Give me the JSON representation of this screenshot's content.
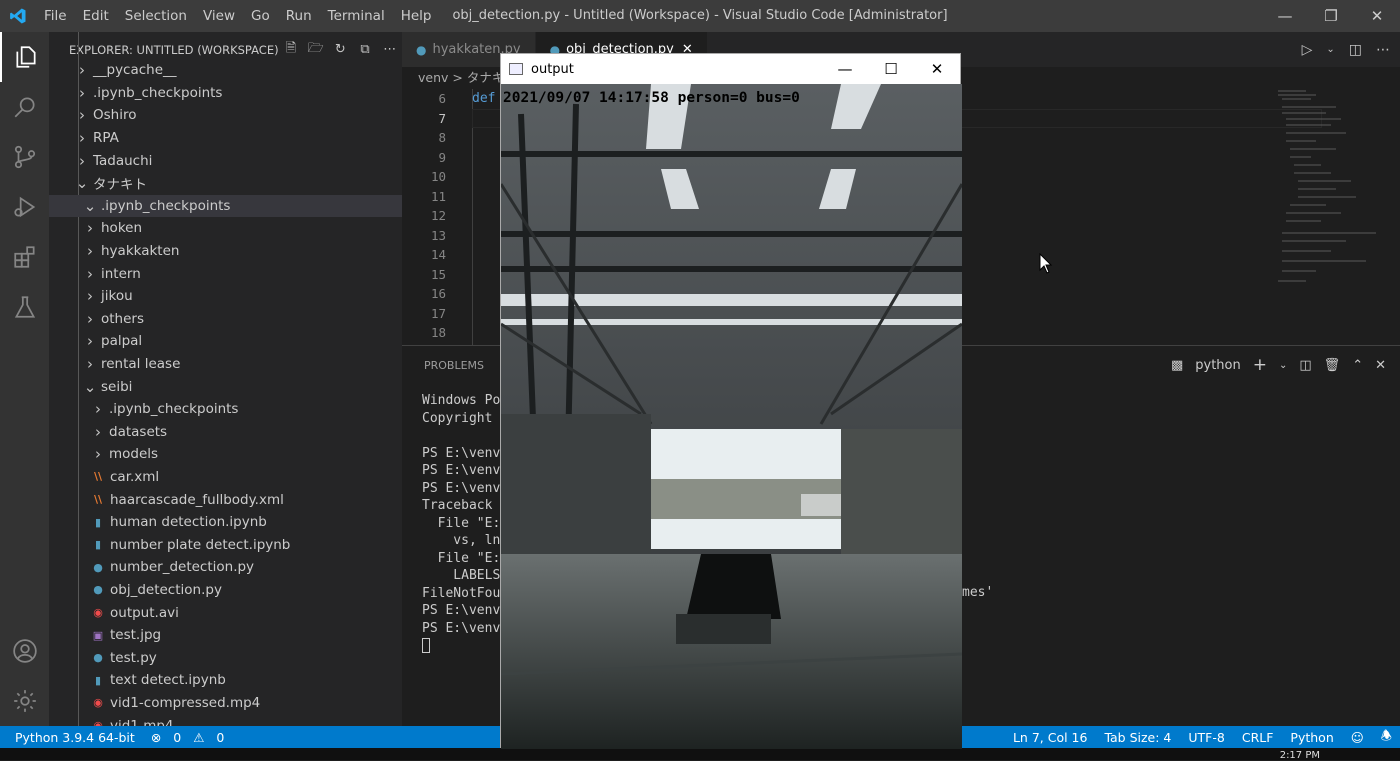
{
  "titlebar": {
    "menu": [
      "File",
      "Edit",
      "Selection",
      "View",
      "Go",
      "Run",
      "Terminal",
      "Help"
    ],
    "title": "obj_detection.py - Untitled (Workspace) - Visual Studio Code [Administrator]"
  },
  "sidebar": {
    "header": "EXPLORER: UNTITLED (WORKSPACE)",
    "items": [
      {
        "label": "__pycache__",
        "kind": "folder",
        "depth": 1,
        "open": false
      },
      {
        "label": ".ipynb_checkpoints",
        "kind": "folder",
        "depth": 1,
        "open": false
      },
      {
        "label": "Oshiro",
        "kind": "folder",
        "depth": 1,
        "open": false
      },
      {
        "label": "RPA",
        "kind": "folder",
        "depth": 1,
        "open": false
      },
      {
        "label": "Tadauchi",
        "kind": "folder",
        "depth": 1,
        "open": false
      },
      {
        "label": "タナキト",
        "kind": "folder",
        "depth": 1,
        "open": true
      },
      {
        "label": ".ipynb_checkpoints",
        "kind": "folder",
        "depth": 2,
        "open": true,
        "selected": true
      },
      {
        "label": "hoken",
        "kind": "folder",
        "depth": 2,
        "open": false
      },
      {
        "label": "hyakkakten",
        "kind": "folder",
        "depth": 2,
        "open": false
      },
      {
        "label": "intern",
        "kind": "folder",
        "depth": 2,
        "open": false
      },
      {
        "label": "jikou",
        "kind": "folder",
        "depth": 2,
        "open": false
      },
      {
        "label": "others",
        "kind": "folder",
        "depth": 2,
        "open": false
      },
      {
        "label": "palpal",
        "kind": "folder",
        "depth": 2,
        "open": false
      },
      {
        "label": "rental lease",
        "kind": "folder",
        "depth": 2,
        "open": false
      },
      {
        "label": "seibi",
        "kind": "folder",
        "depth": 2,
        "open": true
      },
      {
        "label": ".ipynb_checkpoints",
        "kind": "folder",
        "depth": 3,
        "open": false
      },
      {
        "label": "datasets",
        "kind": "folder",
        "depth": 3,
        "open": false
      },
      {
        "label": "models",
        "kind": "folder",
        "depth": 3,
        "open": false
      },
      {
        "label": "car.xml",
        "kind": "xml",
        "depth": 3
      },
      {
        "label": "haarcascade_fullbody.xml",
        "kind": "xml",
        "depth": 3
      },
      {
        "label": "human detection.ipynb",
        "kind": "nb",
        "depth": 3
      },
      {
        "label": "number plate detect.ipynb",
        "kind": "nb",
        "depth": 3
      },
      {
        "label": "number_detection.py",
        "kind": "py",
        "depth": 3
      },
      {
        "label": "obj_detection.py",
        "kind": "py",
        "depth": 3
      },
      {
        "label": "output.avi",
        "kind": "video",
        "depth": 3
      },
      {
        "label": "test.jpg",
        "kind": "img",
        "depth": 3
      },
      {
        "label": "test.py",
        "kind": "py",
        "depth": 3
      },
      {
        "label": "text detect.ipynb",
        "kind": "nb",
        "depth": 3
      },
      {
        "label": "vid1-compressed.mp4",
        "kind": "video",
        "depth": 3
      },
      {
        "label": "vid1.mp4",
        "kind": "video",
        "depth": 3
      }
    ]
  },
  "tabs": [
    {
      "label": "hyakkaten.py",
      "active": false
    },
    {
      "label": "obj_detection.py",
      "active": true
    }
  ],
  "breadcrumb": "venv > タナキ",
  "editor": {
    "line_numbers": [
      "6",
      "7",
      "8",
      "9",
      "10",
      "11",
      "12",
      "13",
      "14",
      "15",
      "16",
      "17",
      "18"
    ],
    "current_line": "7",
    "code_fragment": "def"
  },
  "panel": {
    "tab": "PROBLEMS",
    "shell": "python",
    "terminal_lines": [
      "Windows Pow",
      "Copyright (",
      "",
      "PS E:\\venv\\",
      "PS E:\\venv\\",
      "PS E:\\venv\\",
      "Traceback (",
      "  File \"E:\\",
      "    vs, ln,",
      "  File \"E:\\",
      "    LABELS",
      "FileNotFoun",
      "PS E:\\venv\\",
      "PS E:\\venv\\"
    ],
    "terminal_right_fragment": "mes'"
  },
  "output_window": {
    "title": "output",
    "overlay": "2021/09/07 14:17:58 person=0 bus=0"
  },
  "statusbar": {
    "python": "Python 3.9.4 64-bit",
    "errors": "0",
    "warnings": "0",
    "position": "Ln 7, Col 16",
    "tab_size": "Tab Size: 4",
    "encoding": "UTF-8",
    "eol": "CRLF",
    "language": "Python"
  },
  "taskbar": {
    "clock": "2:17 PM"
  },
  "colors": {
    "accent": "#007acc",
    "sidebar_bg": "#252526",
    "editor_bg": "#1e1e1e"
  }
}
